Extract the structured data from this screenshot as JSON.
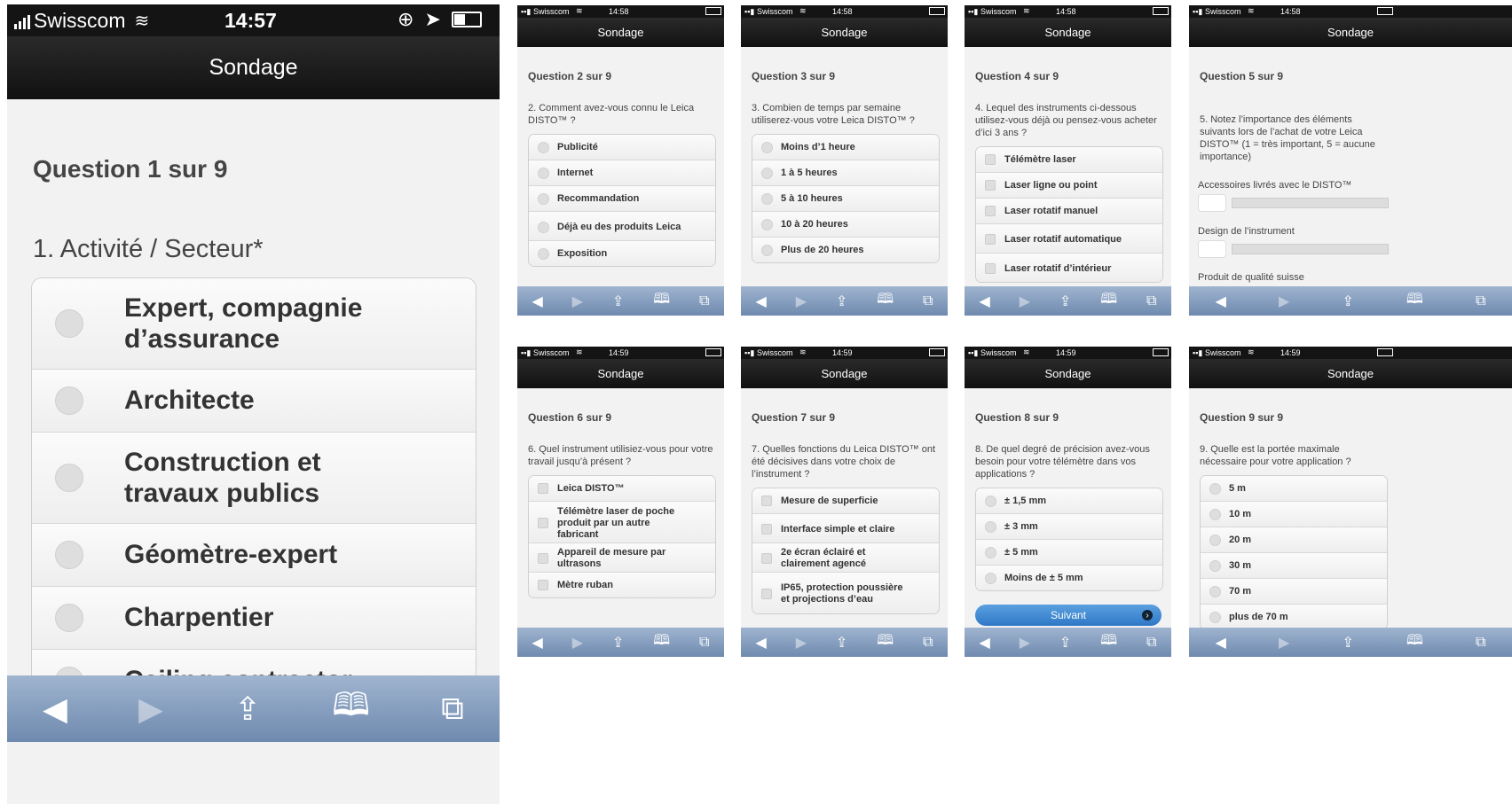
{
  "status": {
    "carrier": "Swisscom",
    "times": [
      "14:57",
      "14:58",
      "14:58",
      "14:58",
      "14:58",
      "14:59",
      "14:59",
      "14:59",
      "14:59"
    ]
  },
  "nav_title": "Sondage",
  "big": {
    "question_header": "Question 1 sur 9",
    "question_text": "1. Activité / Secteur*",
    "options": [
      "Expert, compagnie d’assurance",
      "Architecte",
      "Construction et travaux publics",
      "Géomètre-expert",
      "Charpentier",
      "Ceiling contractor"
    ]
  },
  "small": [
    {
      "header": "Question 2 sur 9",
      "text": "2. Comment avez-vous connu le Leica DISTO™ ?",
      "type": "radio",
      "options": [
        "Publicité",
        "Internet",
        "Recommandation",
        "Déjà eu des produits Leica",
        "Exposition"
      ]
    },
    {
      "header": "Question 3 sur 9",
      "text": "3. Combien de temps par semaine utiliserez-vous votre Leica DISTO™ ?",
      "type": "radio",
      "options": [
        "Moins d’1 heure",
        "1 à 5 heures",
        "5 à 10 heures",
        "10 à 20 heures",
        "Plus de 20 heures"
      ]
    },
    {
      "header": "Question 4 sur 9",
      "text": "4. Lequel des instruments ci-dessous utilisez-vous déjà ou pensez-vous acheter d’ici 3 ans ?",
      "type": "check",
      "options": [
        "Télémètre laser",
        "Laser ligne ou point",
        "Laser rotatif manuel",
        "Laser rotatif automatique",
        "Laser rotatif d’intérieur"
      ]
    },
    {
      "header": "Question 5 sur 9",
      "text": "5. Notez l’importance des éléments suivants lors de l’achat de votre Leica DISTO™ (1 = très important, 5 = aucune importance)",
      "type": "slider",
      "options": [
        "Accessoires livrés avec le DISTO™",
        "Design de l’instrument",
        "Produit de qualité suisse"
      ]
    },
    {
      "header": "Question 6 sur 9",
      "text": "6. Quel instrument utilisiez-vous pour votre travail jusqu’à présent ?",
      "type": "check",
      "options": [
        "Leica DISTO™",
        "Télémètre laser de poche produit par un autre fabricant",
        "Appareil de mesure par ultrasons",
        "Mètre ruban"
      ]
    },
    {
      "header": "Question 7 sur 9",
      "text": "7. Quelles fonctions du Leica DISTO™ ont été décisives dans votre choix de l’instrument ?",
      "type": "check",
      "options": [
        "Mesure de superficie",
        "Interface simple et claire",
        "2e écran éclairé et clairement agencé",
        "IP65, protection poussière et projections d’eau"
      ]
    },
    {
      "header": "Question 8 sur 9",
      "text": "8. De quel degré de précision avez-vous besoin pour votre télémètre dans vos applications ?",
      "type": "radio",
      "options": [
        "± 1,5 mm",
        "± 3 mm",
        "± 5 mm",
        "Moins de ± 5 mm"
      ],
      "button": "Suivant"
    },
    {
      "header": "Question 9 sur 9",
      "text": "9. Quelle est la portée maximale nécessaire pour votre application ?",
      "type": "radio",
      "options": [
        "5 m",
        "10 m",
        "20 m",
        "30 m",
        "70 m",
        "plus de 70 m"
      ]
    }
  ]
}
